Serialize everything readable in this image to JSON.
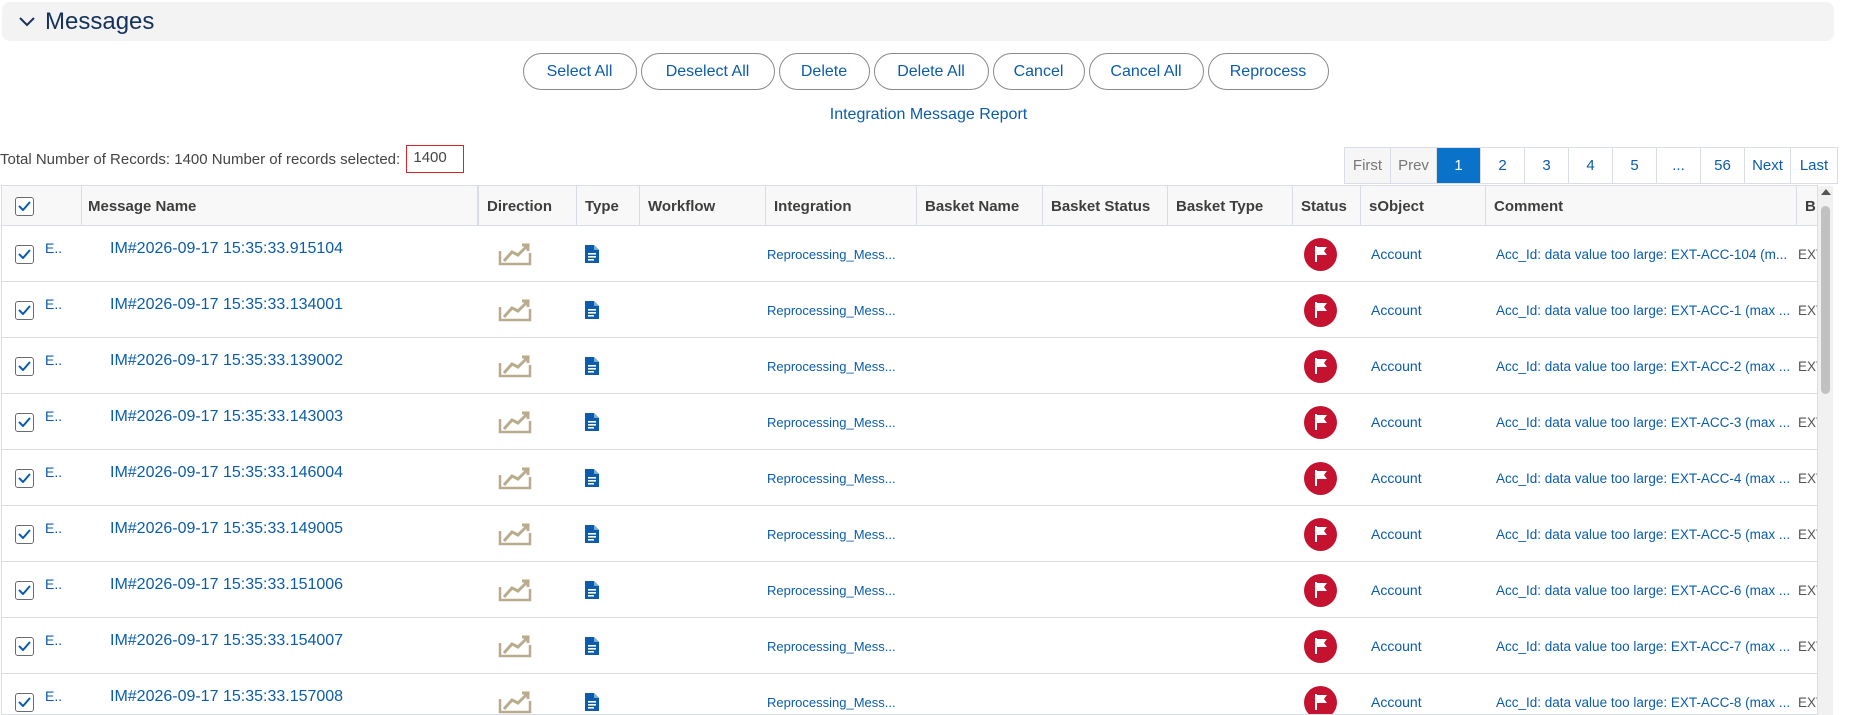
{
  "section": {
    "title": "Messages",
    "icon": "chevron-down-icon"
  },
  "actions": {
    "select_all": "Select All",
    "deselect_all": "Deselect All",
    "delete": "Delete",
    "delete_all": "Delete All",
    "cancel": "Cancel",
    "cancel_all": "Cancel All",
    "reprocess": "Reprocess"
  },
  "report_link": "Integration Message Report",
  "totals": {
    "total_text": "Total Number of Records: 1400 Number of records selected:",
    "selected_count": "1400"
  },
  "pagination": {
    "first": "First",
    "prev": "Prev",
    "pages": [
      "1",
      "2",
      "3",
      "4",
      "5",
      "...",
      "56"
    ],
    "current": "1",
    "next": "Next",
    "last": "Last"
  },
  "table": {
    "columns": {
      "message_name": "Message Name",
      "direction": "Direction",
      "type": "Type",
      "workflow": "Workflow",
      "integration": "Integration",
      "basket_name": "Basket Name",
      "basket_status": "Basket Status",
      "basket_type": "Basket Type",
      "status": "Status",
      "sobject": "sObject",
      "comment": "Comment",
      "b_col": "B"
    },
    "rows": [
      {
        "expand": "E..",
        "name": "IM#2026-09-17 15:35:33.915104",
        "integration": "Reprocessing_Mess...",
        "sobject": "Account",
        "comment": "Acc_Id: data value too large: EXT-ACC-104 (m...",
        "b": "EXT"
      },
      {
        "expand": "E..",
        "name": "IM#2026-09-17 15:35:33.134001",
        "integration": "Reprocessing_Mess...",
        "sobject": "Account",
        "comment": "Acc_Id: data value too large: EXT-ACC-1 (max ...",
        "b": "EXT"
      },
      {
        "expand": "E..",
        "name": "IM#2026-09-17 15:35:33.139002",
        "integration": "Reprocessing_Mess...",
        "sobject": "Account",
        "comment": "Acc_Id: data value too large: EXT-ACC-2 (max ...",
        "b": "EXT"
      },
      {
        "expand": "E..",
        "name": "IM#2026-09-17 15:35:33.143003",
        "integration": "Reprocessing_Mess...",
        "sobject": "Account",
        "comment": "Acc_Id: data value too large: EXT-ACC-3 (max ...",
        "b": "EXT"
      },
      {
        "expand": "E..",
        "name": "IM#2026-09-17 15:35:33.146004",
        "integration": "Reprocessing_Mess...",
        "sobject": "Account",
        "comment": "Acc_Id: data value too large: EXT-ACC-4 (max ...",
        "b": "EXT"
      },
      {
        "expand": "E..",
        "name": "IM#2026-09-17 15:35:33.149005",
        "integration": "Reprocessing_Mess...",
        "sobject": "Account",
        "comment": "Acc_Id: data value too large: EXT-ACC-5 (max ...",
        "b": "EXT"
      },
      {
        "expand": "E..",
        "name": "IM#2026-09-17 15:35:33.151006",
        "integration": "Reprocessing_Mess...",
        "sobject": "Account",
        "comment": "Acc_Id: data value too large: EXT-ACC-6 (max ...",
        "b": "EXT"
      },
      {
        "expand": "E..",
        "name": "IM#2026-09-17 15:35:33.154007",
        "integration": "Reprocessing_Mess...",
        "sobject": "Account",
        "comment": "Acc_Id: data value too large: EXT-ACC-7 (max ...",
        "b": "EXT"
      },
      {
        "expand": "E..",
        "name": "IM#2026-09-17 15:35:33.157008",
        "integration": "Reprocessing_Mess...",
        "sobject": "Account",
        "comment": "Acc_Id: data value too large: EXT-ACC-8 (max ...",
        "b": "EXT"
      }
    ]
  },
  "icons": {
    "direction": "inbound-tray-icon",
    "type": "document-icon",
    "status": "flag-icon",
    "checkbox": "checkbox-checked-icon"
  },
  "colors": {
    "link": "#0b5cab",
    "active_page": "#0b72c9",
    "status_error": "#c41230",
    "direction_icon": "#b9ab8e",
    "highlight_border": "#d9242b"
  }
}
